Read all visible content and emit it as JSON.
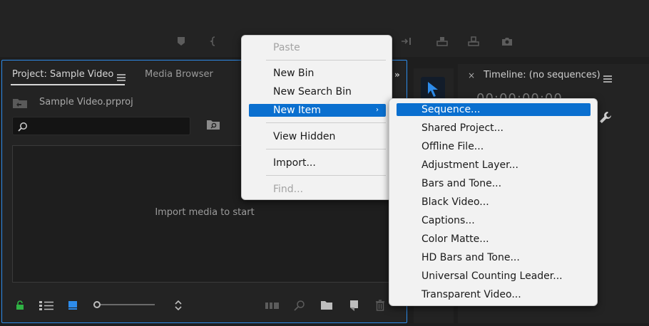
{
  "program_monitor": {
    "icons": [
      "marker-icon",
      "mark-in-icon",
      "overwrite-icon",
      "lift-icon",
      "extract-icon",
      "camera-icon"
    ]
  },
  "project_panel": {
    "tab_project": "Project: Sample Video",
    "tab_media": "Media Browser",
    "file_name": "Sample Video.prproj",
    "search_placeholder": "",
    "empty_message": "Import media to start"
  },
  "timeline": {
    "title": "Timeline: (no sequences)",
    "close_glyph": "×",
    "timecode": "00:00:00:00"
  },
  "context_menu": {
    "items": [
      {
        "label": "Paste",
        "state": "disabled"
      },
      {
        "label": "New Bin",
        "state": "normal"
      },
      {
        "label": "New Search Bin",
        "state": "normal"
      },
      {
        "label": "New Item",
        "state": "active",
        "has_submenu": true
      },
      {
        "label": "View Hidden",
        "state": "normal"
      },
      {
        "label": "Import...",
        "state": "normal"
      },
      {
        "label": "Find...",
        "state": "disabled"
      }
    ],
    "submenu_arrow": "›"
  },
  "new_item_submenu": {
    "items": [
      "Sequence...",
      "Shared Project...",
      "Offline File...",
      "Adjustment Layer...",
      "Bars and Tone...",
      "Black Video...",
      "Captions...",
      "Color Matte...",
      "HD Bars and Tone...",
      "Universal Counting Leader...",
      "Transparent Video..."
    ],
    "active_index": 0
  },
  "colors": {
    "accent": "#0a6fcf",
    "panel_focus_border": "#2d8ceb",
    "lock_green": "#2fb344",
    "icon_blue": "#2d8ceb"
  }
}
